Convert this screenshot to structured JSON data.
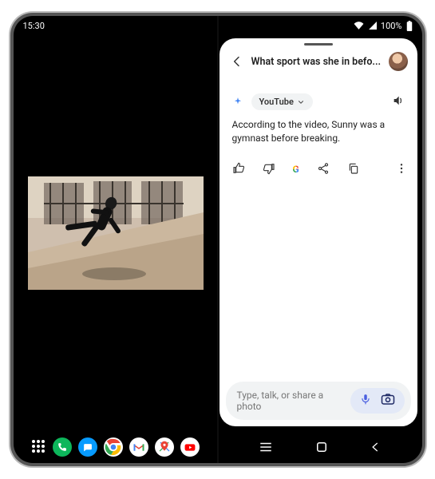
{
  "statusbar": {
    "time": "15:30",
    "battery_text": "100%"
  },
  "assistant": {
    "header_title": "What sport was she in befo...",
    "source_chip": "YouTube",
    "answer": "According to the video, Sunny was a gymnast before breaking.",
    "input_placeholder": "Type, talk, or share a photo"
  },
  "icons": {
    "back": "back-icon",
    "avatar": "user-avatar",
    "sparkle": "sparkle-icon",
    "chevron_down": "chevron-down-icon",
    "volume": "volume-icon",
    "thumbs_up": "thumbs-up-icon",
    "thumbs_down": "thumbs-down-icon",
    "google": "google-g-icon",
    "share": "share-icon",
    "copy": "copy-icon",
    "more": "more-vert-icon",
    "mic": "mic-icon",
    "camera": "camera-icon",
    "apps": "apps-grid-icon",
    "phone": "phone-app-icon",
    "messages": "messages-app-icon",
    "chrome": "chrome-app-icon",
    "gmail": "gmail-app-icon",
    "maps": "maps-app-icon",
    "youtube": "youtube-app-icon",
    "nav_recents": "nav-recents-icon",
    "nav_home": "nav-home-icon",
    "nav_back": "nav-back-icon",
    "wifi": "wifi-icon",
    "signal": "signal-icon",
    "battery": "battery-icon"
  },
  "colors": {
    "accent_pill": "#e3e9f7",
    "chip_bg": "#f1f3f4",
    "google_blue": "#4285f4",
    "google_red": "#ea4335",
    "google_yellow": "#fbbc05",
    "google_green": "#34a853"
  }
}
